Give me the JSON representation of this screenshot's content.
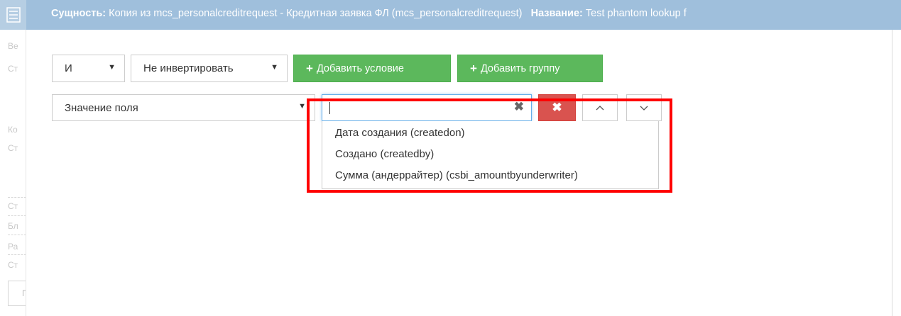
{
  "header": {
    "entity_label": "Сущность:",
    "entity_value": "Копия из mcs_personalcreditrequest - Кредитная заявка ФЛ (mcs_personalcreditrequest)",
    "name_label": "Название:",
    "name_value": "Test phantom lookup f"
  },
  "left_panel": {
    "labels": [
      "Ве",
      "Ст",
      "Ко",
      "Ст",
      "Ст",
      "Бл",
      "Ра",
      "Ст",
      "П"
    ]
  },
  "toolbar": {
    "logic_select": "И",
    "invert_select": "Не инвертировать",
    "add_condition_label": "Добавить условие",
    "add_group_label": "Добавить группу"
  },
  "condition": {
    "type_select": "Значение поля",
    "field_input_value": "",
    "clear_glyph": "✖",
    "delete_glyph": "✖",
    "up_glyph": "︿",
    "down_glyph": "﹀"
  },
  "dropdown": {
    "options": [
      "Дата создания (createdon)",
      "Создано (createdby)",
      "Сумма (андеррайтер) (csbi_amountbyunderwriter)"
    ]
  },
  "colors": {
    "header_bg": "#9fbfdc",
    "green": "#5cb85c",
    "danger": "#d9534f",
    "highlight": "#ff0000",
    "focus": "#66afe9"
  }
}
